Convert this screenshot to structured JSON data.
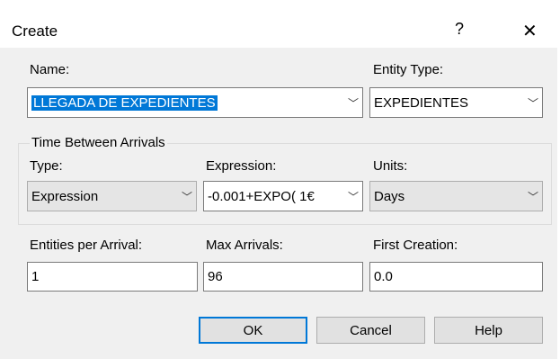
{
  "window": {
    "title": "Create",
    "help_glyph": "?",
    "close_glyph": "✕"
  },
  "name": {
    "label": "Name:",
    "value": "LLEGADA DE EXPEDIENTES"
  },
  "entity_type": {
    "label": "Entity Type:",
    "value": "EXPEDIENTES"
  },
  "time_between_arrivals": {
    "legend": "Time Between Arrivals",
    "type_label": "Type:",
    "type_value": "Expression",
    "expression_label": "Expression:",
    "expression_value": "-0.001+EXPO( 1€",
    "units_label": "Units:",
    "units_value": "Days"
  },
  "entities_per_arrival": {
    "label": "Entities per Arrival:",
    "value": "1"
  },
  "max_arrivals": {
    "label": "Max Arrivals:",
    "value": "96"
  },
  "first_creation": {
    "label": "First Creation:",
    "value": "0.0"
  },
  "buttons": {
    "ok": "OK",
    "cancel": "Cancel",
    "help": "Help"
  },
  "icons": {
    "dropdown": "chevron-down-icon"
  }
}
